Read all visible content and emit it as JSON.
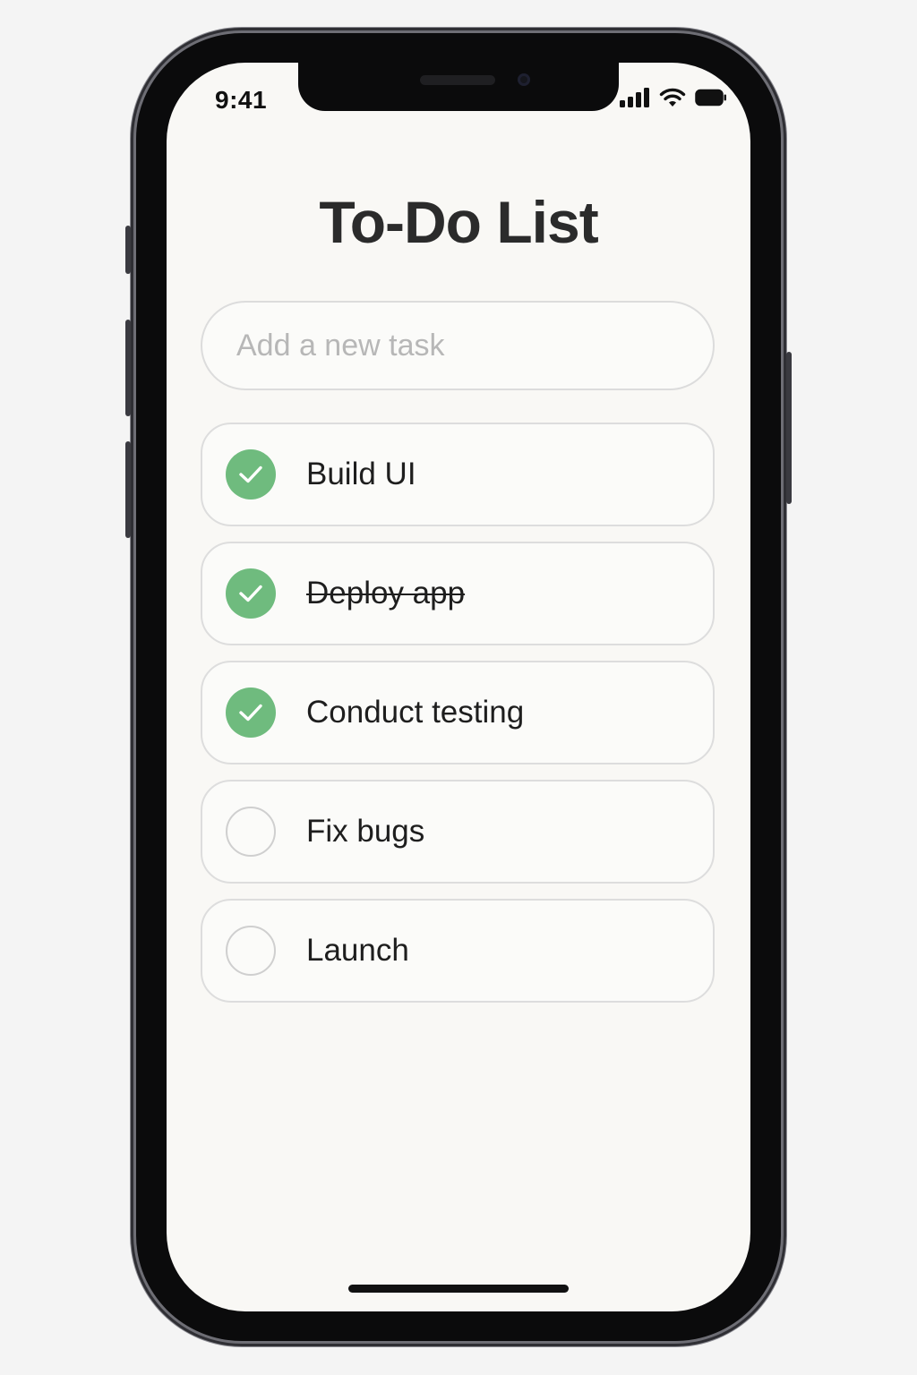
{
  "status_bar": {
    "time": "9:41",
    "icons": [
      "cellular-signal-icon",
      "wifi-icon",
      "battery-icon"
    ]
  },
  "title": "To-Do List",
  "new_task": {
    "placeholder": "Add a new task",
    "value": ""
  },
  "tasks": [
    {
      "label": "Build UI",
      "done": true,
      "strikethrough": false
    },
    {
      "label": "Deploy app",
      "done": true,
      "strikethrough": true
    },
    {
      "label": "Conduct testing",
      "done": true,
      "strikethrough": false
    },
    {
      "label": "Fix bugs",
      "done": false,
      "strikethrough": false
    },
    {
      "label": "Launch",
      "done": false,
      "strikethrough": false
    }
  ],
  "colors": {
    "done_check": "#6fbb7e",
    "screen_bg": "#f9f8f5",
    "title": "#2b2b2b"
  }
}
